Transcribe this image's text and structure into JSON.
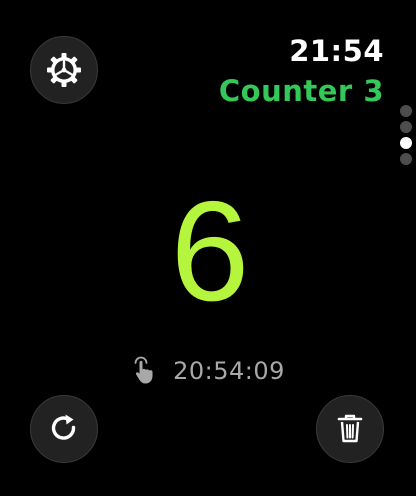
{
  "status": {
    "time": "21:54"
  },
  "counter": {
    "name": "Counter 3",
    "value": "6",
    "last_tap_time": "20:54:09",
    "value_color": "#b5f53d",
    "name_color": "#34c759"
  },
  "pagination": {
    "total": 4,
    "current": 3
  },
  "icons": {
    "settings": "gear-icon",
    "last_tap": "tap-hand-icon",
    "reset": "reset-arrow-icon",
    "delete": "trash-icon"
  }
}
